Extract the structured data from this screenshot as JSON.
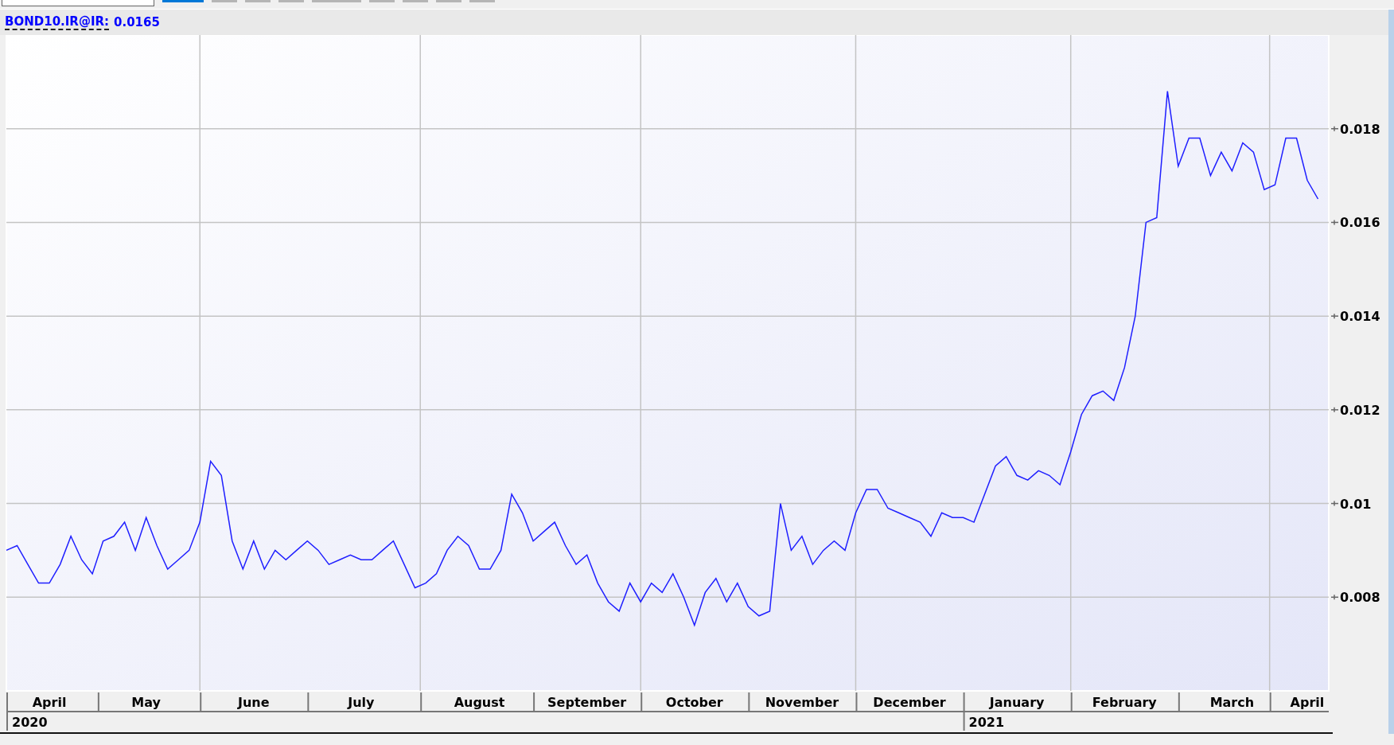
{
  "toolbar": {
    "tabs": [
      {
        "selected": true
      },
      {
        "selected": false
      },
      {
        "selected": false
      },
      {
        "selected": false
      },
      {
        "selected": false
      },
      {
        "selected": false
      },
      {
        "selected": false
      },
      {
        "selected": false
      },
      {
        "selected": false
      }
    ]
  },
  "header": {
    "symbol": "BOND10.IR@IR:",
    "value": "0.0165"
  },
  "chart_data": {
    "type": "line",
    "ylim": [
      0.006,
      0.02
    ],
    "yticks": [
      0.008,
      0.01,
      0.012,
      0.014,
      0.016,
      0.018
    ],
    "grid": true,
    "categories": [
      null,
      null,
      null,
      null,
      "April",
      null,
      null,
      null,
      null,
      null,
      null,
      null,
      null,
      "May",
      null,
      null,
      null,
      null,
      null,
      null,
      null,
      null,
      null,
      "June",
      null,
      null,
      null,
      null,
      null,
      null,
      null,
      null,
      null,
      "July",
      null,
      null,
      null,
      null,
      null,
      null,
      null,
      null,
      null,
      null,
      "August",
      null,
      null,
      null,
      null,
      null,
      null,
      null,
      null,
      null,
      "September",
      null,
      null,
      null,
      null,
      null,
      null,
      null,
      null,
      null,
      "October",
      null,
      null,
      null,
      null,
      null,
      null,
      null,
      null,
      null,
      "November",
      null,
      null,
      null,
      null,
      null,
      null,
      null,
      null,
      null,
      "December",
      null,
      null,
      null,
      null,
      null,
      null,
      null,
      null,
      null,
      "January",
      null,
      null,
      null,
      null,
      null,
      null,
      null,
      null,
      null,
      "February",
      null,
      null,
      null,
      null,
      null,
      null,
      null,
      null,
      null,
      "March",
      null,
      null,
      null,
      null,
      null,
      null,
      "April",
      null
    ],
    "annotations": [
      "2020",
      "2021"
    ],
    "series": [
      {
        "color": "#1f1fff",
        "values": [
          0.009,
          0.0091,
          0.0087,
          0.0083,
          0.0083,
          0.0087,
          0.0093,
          0.0088,
          0.0085,
          0.0092,
          0.0093,
          0.0096,
          0.009,
          0.0097,
          0.0091,
          0.0086,
          0.0088,
          0.009,
          0.0096,
          0.0109,
          0.0106,
          0.0092,
          0.0086,
          0.0092,
          0.0086,
          0.009,
          0.0088,
          0.009,
          0.0092,
          0.009,
          0.0087,
          0.0088,
          0.0089,
          0.0088,
          0.0088,
          0.009,
          0.0092,
          0.0087,
          0.0082,
          0.0083,
          0.0085,
          0.009,
          0.0093,
          0.0091,
          0.0086,
          0.0086,
          0.009,
          0.0102,
          0.0098,
          0.0092,
          0.0094,
          0.0096,
          0.0091,
          0.0087,
          0.0089,
          0.0083,
          0.0079,
          0.0077,
          0.0083,
          0.0079,
          0.0083,
          0.0081,
          0.0085,
          0.008,
          0.0074,
          0.0081,
          0.0084,
          0.0079,
          0.0083,
          0.0078,
          0.0076,
          0.0077,
          0.01,
          0.009,
          0.0093,
          0.0087,
          0.009,
          0.0092,
          0.009,
          0.0098,
          0.0103,
          0.0103,
          0.0099,
          0.0098,
          0.0097,
          0.0096,
          0.0093,
          0.0098,
          0.0097,
          0.0097,
          0.0096,
          0.0102,
          0.0108,
          0.011,
          0.0106,
          0.0105,
          0.0107,
          0.0106,
          0.0104,
          0.0111,
          0.0119,
          0.0123,
          0.0124,
          0.0122,
          0.0129,
          0.014,
          0.016,
          0.0161,
          0.0188,
          0.0172,
          0.0178,
          0.0178,
          0.017,
          0.0175,
          0.0171,
          0.0177,
          0.0175,
          0.0167,
          0.0168,
          0.0178,
          0.0178,
          0.0169,
          0.0165
        ]
      }
    ]
  }
}
